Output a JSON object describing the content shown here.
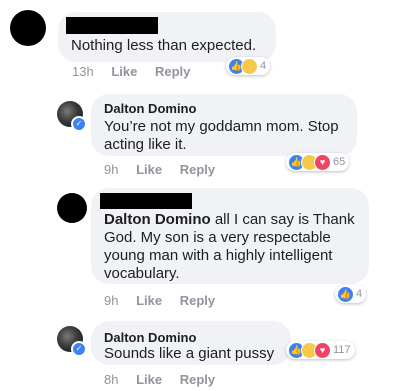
{
  "comments": [
    {
      "author": "",
      "text": "Nothing less than expected.",
      "time": "13h",
      "like_label": "Like",
      "reply_label": "Reply",
      "reaction_count": "4",
      "reactions": [
        "like-icon",
        "haha-icon"
      ]
    },
    {
      "author": "Dalton Domino",
      "text_line1": "You’re not my goddamn mom. Stop",
      "text_line2": "acting like it.",
      "time": "9h",
      "like_label": "Like",
      "reply_label": "Reply",
      "reaction_count": "65",
      "reactions": [
        "like-icon",
        "haha-icon",
        "love-icon"
      ]
    },
    {
      "author": "Dalton Domino",
      "text_line1_rest": " all I can say is Thank",
      "text_line2": "God. My son is a very respectable",
      "text_line3": "young man with a highly intelligent",
      "text_line4": "vocabulary.",
      "time": "9h",
      "like_label": "Like",
      "reply_label": "Reply",
      "reaction_count": "4",
      "reactions": [
        "like-icon"
      ]
    },
    {
      "author": "Dalton Domino",
      "text": "Sounds like a giant pussy",
      "time": "8h",
      "like_label": "Like",
      "reply_label": "Reply",
      "reaction_count": "117",
      "reactions": [
        "like-icon",
        "haha-icon",
        "love-icon"
      ]
    }
  ],
  "colors": {
    "bubble": "#f0f2f5",
    "meta_text": "#90949c",
    "like_blue": "#3b82f6",
    "love_red": "#ef4565",
    "haha_yellow": "#f7c948"
  }
}
